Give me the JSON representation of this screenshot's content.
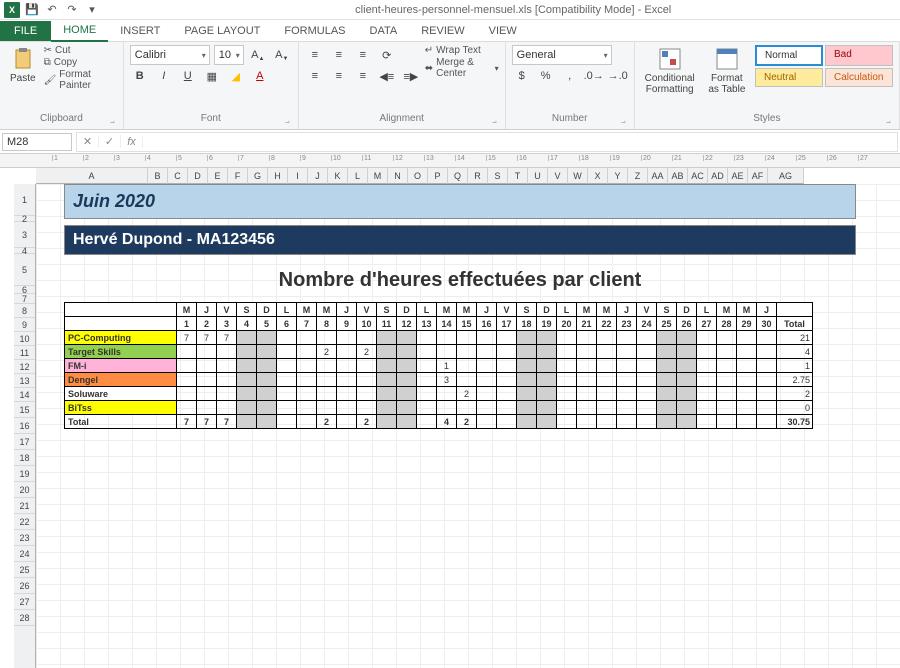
{
  "titlebar": {
    "title": "client-heures-personnel-mensuel.xls [Compatibility Mode] - Excel"
  },
  "tabs": {
    "file": "FILE",
    "home": "HOME",
    "insert": "INSERT",
    "page": "PAGE LAYOUT",
    "formulas": "FORMULAS",
    "data": "DATA",
    "review": "REVIEW",
    "view": "VIEW"
  },
  "ribbon": {
    "paste": "Paste",
    "cut": "Cut",
    "copy": "Copy",
    "fmtpainter": "Format Painter",
    "clipboard": "Clipboard",
    "fontname": "Calibri",
    "fontsize": "10",
    "fontgroup": "Font",
    "wrap": "Wrap Text",
    "merge": "Merge & Center",
    "align": "Alignment",
    "numfmt": "General",
    "numgroup": "Number",
    "cond": "Conditional Formatting",
    "fmtas": "Format as Table",
    "stylesgroup": "Styles",
    "style_normal": "Normal",
    "style_bad": "Bad",
    "style_neutral": "Neutral",
    "style_calc": "Calculation"
  },
  "namebox": "M28",
  "sheet": {
    "month": "Juin 2020",
    "person": "Hervé Dupond -  MA123456",
    "title": "Nombre d'heures effectuées par client",
    "dayletters": [
      "M",
      "J",
      "V",
      "S",
      "D",
      "L",
      "M",
      "M",
      "J",
      "V",
      "S",
      "D",
      "L",
      "M",
      "M",
      "J",
      "V",
      "S",
      "D",
      "L",
      "M",
      "M",
      "J",
      "V",
      "S",
      "D",
      "L",
      "M",
      "M",
      "J"
    ],
    "daynums": [
      1,
      2,
      3,
      4,
      5,
      6,
      7,
      8,
      9,
      10,
      11,
      12,
      13,
      14,
      15,
      16,
      17,
      18,
      19,
      20,
      21,
      22,
      23,
      24,
      25,
      26,
      27,
      28,
      29,
      30
    ],
    "weekend": [
      false,
      false,
      false,
      true,
      true,
      false,
      false,
      false,
      false,
      false,
      true,
      true,
      false,
      false,
      false,
      false,
      false,
      true,
      true,
      false,
      false,
      false,
      false,
      false,
      true,
      true,
      false,
      false,
      false,
      false
    ],
    "total_label": "Total",
    "clients": [
      {
        "name": "PC-Computing",
        "cls": "pc",
        "vals": [
          7,
          7,
          7,
          "",
          "",
          "",
          "",
          "",
          "",
          "",
          "",
          "",
          "",
          "",
          "",
          "",
          "",
          "",
          "",
          "",
          "",
          "",
          "",
          "",
          "",
          "",
          "",
          "",
          "",
          ""
        ],
        "tot": "21"
      },
      {
        "name": "Target Skills",
        "cls": "ts",
        "vals": [
          "",
          "",
          "",
          "",
          "",
          "",
          "",
          2,
          "",
          2,
          "",
          "",
          "",
          "",
          "",
          "",
          "",
          "",
          "",
          "",
          "",
          "",
          "",
          "",
          "",
          "",
          "",
          "",
          "",
          ""
        ],
        "tot": "4"
      },
      {
        "name": "FM-i",
        "cls": "fm",
        "vals": [
          "",
          "",
          "",
          "",
          "",
          "",
          "",
          "",
          "",
          "",
          "",
          "",
          "",
          1,
          "",
          "",
          "",
          "",
          "",
          "",
          "",
          "",
          "",
          "",
          "",
          "",
          "",
          "",
          "",
          ""
        ],
        "tot": "1"
      },
      {
        "name": "Dengel",
        "cls": "de",
        "vals": [
          "",
          "",
          "",
          "",
          "",
          "",
          "",
          "",
          "",
          "",
          "",
          "",
          "",
          3,
          "",
          "",
          "",
          "",
          "",
          "",
          "",
          "",
          "",
          "",
          "",
          "",
          "",
          "",
          "",
          ""
        ],
        "tot": "2.75"
      },
      {
        "name": "Soluware",
        "cls": "sw",
        "vals": [
          "",
          "",
          "",
          "",
          "",
          "",
          "",
          "",
          "",
          "",
          "",
          "",
          "",
          "",
          2,
          "",
          "",
          "",
          "",
          "",
          "",
          "",
          "",
          "",
          "",
          "",
          "",
          "",
          "",
          ""
        ],
        "tot": "2"
      },
      {
        "name": "BiTss",
        "cls": "bi",
        "vals": [
          "",
          "",
          "",
          "",
          "",
          "",
          "",
          "",
          "",
          "",
          "",
          "",
          "",
          "",
          "",
          "",
          "",
          "",
          "",
          "",
          "",
          "",
          "",
          "",
          "",
          "",
          "",
          "",
          "",
          ""
        ],
        "tot": "0"
      }
    ],
    "totals": {
      "vals": [
        7,
        7,
        7,
        "",
        "",
        "",
        "",
        2,
        "",
        2,
        "",
        "",
        "",
        4,
        2,
        "",
        "",
        "",
        "",
        "",
        "",
        "",
        "",
        "",
        "",
        "",
        "",
        "",
        "",
        ""
      ],
      "tot": "30.75"
    }
  },
  "colheaders": [
    "A",
    "B",
    "C",
    "D",
    "E",
    "F",
    "G",
    "H",
    "I",
    "J",
    "K",
    "L",
    "M",
    "N",
    "O",
    "P",
    "Q",
    "R",
    "S",
    "T",
    "U",
    "V",
    "W",
    "X",
    "Y",
    "Z",
    "AA",
    "AB",
    "AC",
    "AD",
    "AE",
    "AF",
    "AG"
  ],
  "rulerH": [
    1,
    2,
    3,
    4,
    5,
    6,
    7,
    8,
    9,
    10,
    11,
    12,
    13,
    14,
    15,
    16,
    17,
    18,
    19,
    20,
    21,
    22,
    23,
    24,
    25,
    26,
    27
  ]
}
